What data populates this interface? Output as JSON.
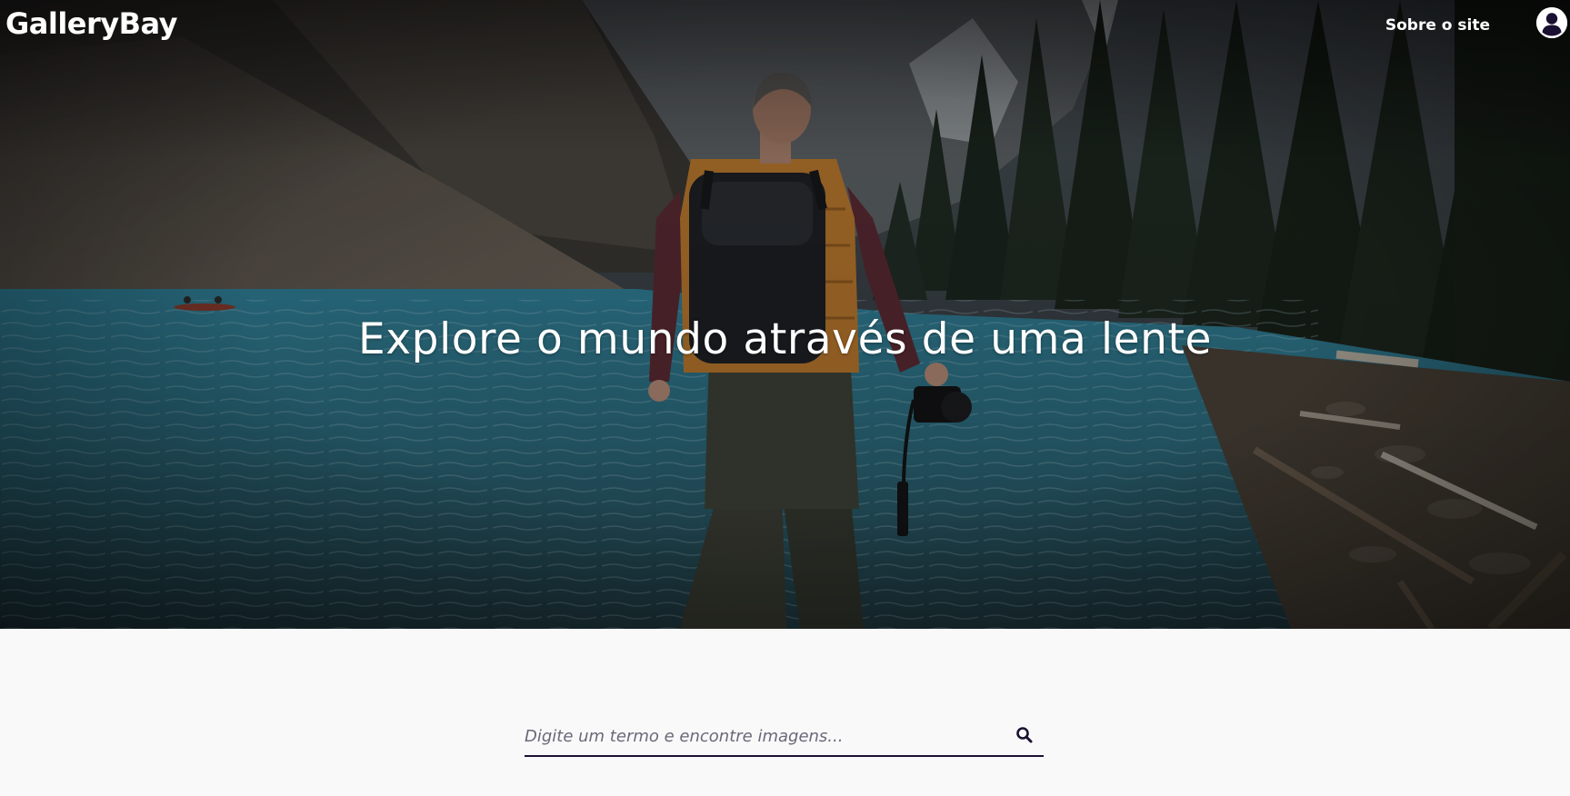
{
  "header": {
    "logo": "GalleryBay",
    "about_link": "Sobre o site",
    "profile_icon": "user-circle-icon"
  },
  "hero": {
    "title": "Explore o mundo através de uma lente",
    "image_description_icon": "hero-photo"
  },
  "search": {
    "placeholder": "Digite um termo e encontre imagens...",
    "value": "",
    "button_icon": "search-icon"
  },
  "colors": {
    "accent": "#1a1031",
    "page_background": "#f9f9fa",
    "text_on_hero": "#ffffff"
  }
}
